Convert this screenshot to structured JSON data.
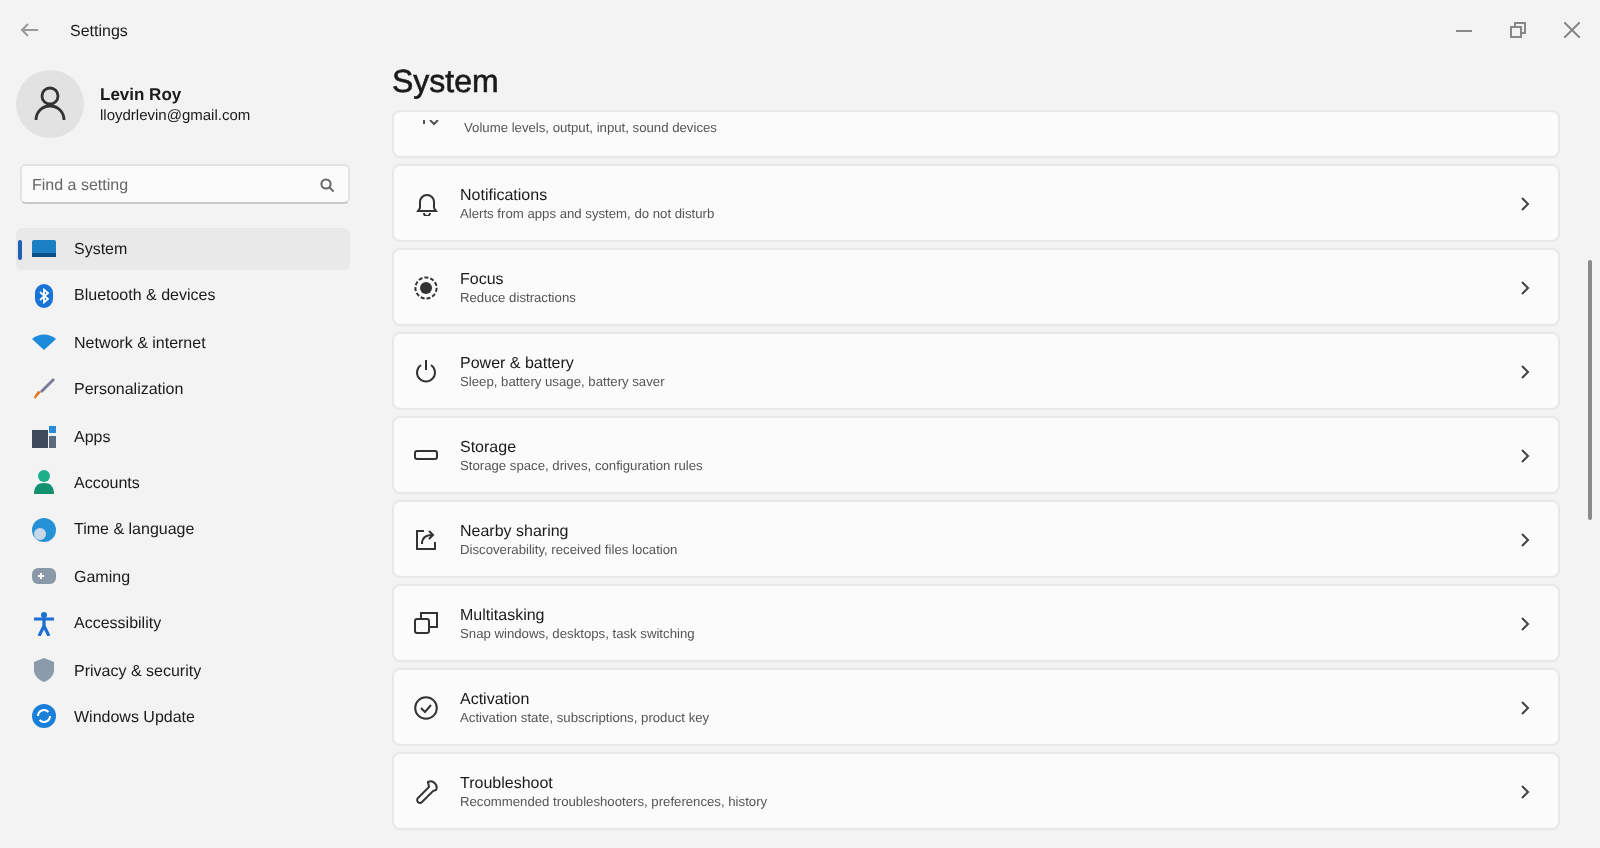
{
  "window": {
    "title": "Settings"
  },
  "user": {
    "name": "Levin Roy",
    "email": "lloydrlevin@gmail.com"
  },
  "search": {
    "placeholder": "Find a setting"
  },
  "sidebar": {
    "items": [
      {
        "label": "System",
        "selected": true
      },
      {
        "label": "Bluetooth & devices",
        "selected": false
      },
      {
        "label": "Network & internet",
        "selected": false
      },
      {
        "label": "Personalization",
        "selected": false
      },
      {
        "label": "Apps",
        "selected": false
      },
      {
        "label": "Accounts",
        "selected": false
      },
      {
        "label": "Time & language",
        "selected": false
      },
      {
        "label": "Gaming",
        "selected": false
      },
      {
        "label": "Accessibility",
        "selected": false
      },
      {
        "label": "Privacy & security",
        "selected": false
      },
      {
        "label": "Windows Update",
        "selected": false
      }
    ]
  },
  "page": {
    "title": "System"
  },
  "settings": [
    {
      "kind": "partial",
      "description": "Volume levels, output, input, sound devices"
    },
    {
      "kind": "full",
      "title": "Notifications",
      "description": "Alerts from apps and system, do not disturb"
    },
    {
      "kind": "full",
      "title": "Focus",
      "description": "Reduce distractions"
    },
    {
      "kind": "full",
      "title": "Power & battery",
      "description": "Sleep, battery usage, battery saver"
    },
    {
      "kind": "full",
      "title": "Storage",
      "description": "Storage space, drives, configuration rules"
    },
    {
      "kind": "full",
      "title": "Nearby sharing",
      "description": "Discoverability, received files location"
    },
    {
      "kind": "full",
      "title": "Multitasking",
      "description": "Snap windows, desktops, task switching"
    },
    {
      "kind": "full",
      "title": "Activation",
      "description": "Activation state, subscriptions, product key"
    },
    {
      "kind": "full",
      "title": "Troubleshoot",
      "description": "Recommended troubleshooters, preferences, history"
    }
  ]
}
